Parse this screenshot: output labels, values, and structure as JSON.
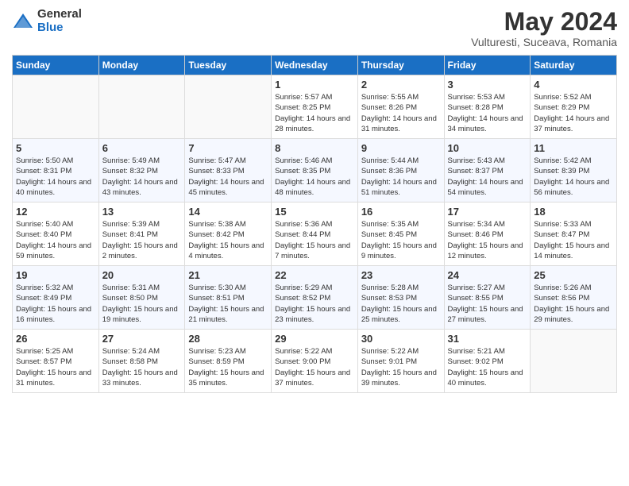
{
  "header": {
    "logo_general": "General",
    "logo_blue": "Blue",
    "main_title": "May 2024",
    "subtitle": "Vulturesti, Suceava, Romania"
  },
  "days_of_week": [
    "Sunday",
    "Monday",
    "Tuesday",
    "Wednesday",
    "Thursday",
    "Friday",
    "Saturday"
  ],
  "weeks": [
    [
      {
        "day": "",
        "info": ""
      },
      {
        "day": "",
        "info": ""
      },
      {
        "day": "",
        "info": ""
      },
      {
        "day": "1",
        "info": "Sunrise: 5:57 AM\nSunset: 8:25 PM\nDaylight: 14 hours\nand 28 minutes."
      },
      {
        "day": "2",
        "info": "Sunrise: 5:55 AM\nSunset: 8:26 PM\nDaylight: 14 hours\nand 31 minutes."
      },
      {
        "day": "3",
        "info": "Sunrise: 5:53 AM\nSunset: 8:28 PM\nDaylight: 14 hours\nand 34 minutes."
      },
      {
        "day": "4",
        "info": "Sunrise: 5:52 AM\nSunset: 8:29 PM\nDaylight: 14 hours\nand 37 minutes."
      }
    ],
    [
      {
        "day": "5",
        "info": "Sunrise: 5:50 AM\nSunset: 8:31 PM\nDaylight: 14 hours\nand 40 minutes."
      },
      {
        "day": "6",
        "info": "Sunrise: 5:49 AM\nSunset: 8:32 PM\nDaylight: 14 hours\nand 43 minutes."
      },
      {
        "day": "7",
        "info": "Sunrise: 5:47 AM\nSunset: 8:33 PM\nDaylight: 14 hours\nand 45 minutes."
      },
      {
        "day": "8",
        "info": "Sunrise: 5:46 AM\nSunset: 8:35 PM\nDaylight: 14 hours\nand 48 minutes."
      },
      {
        "day": "9",
        "info": "Sunrise: 5:44 AM\nSunset: 8:36 PM\nDaylight: 14 hours\nand 51 minutes."
      },
      {
        "day": "10",
        "info": "Sunrise: 5:43 AM\nSunset: 8:37 PM\nDaylight: 14 hours\nand 54 minutes."
      },
      {
        "day": "11",
        "info": "Sunrise: 5:42 AM\nSunset: 8:39 PM\nDaylight: 14 hours\nand 56 minutes."
      }
    ],
    [
      {
        "day": "12",
        "info": "Sunrise: 5:40 AM\nSunset: 8:40 PM\nDaylight: 14 hours\nand 59 minutes."
      },
      {
        "day": "13",
        "info": "Sunrise: 5:39 AM\nSunset: 8:41 PM\nDaylight: 15 hours\nand 2 minutes."
      },
      {
        "day": "14",
        "info": "Sunrise: 5:38 AM\nSunset: 8:42 PM\nDaylight: 15 hours\nand 4 minutes."
      },
      {
        "day": "15",
        "info": "Sunrise: 5:36 AM\nSunset: 8:44 PM\nDaylight: 15 hours\nand 7 minutes."
      },
      {
        "day": "16",
        "info": "Sunrise: 5:35 AM\nSunset: 8:45 PM\nDaylight: 15 hours\nand 9 minutes."
      },
      {
        "day": "17",
        "info": "Sunrise: 5:34 AM\nSunset: 8:46 PM\nDaylight: 15 hours\nand 12 minutes."
      },
      {
        "day": "18",
        "info": "Sunrise: 5:33 AM\nSunset: 8:47 PM\nDaylight: 15 hours\nand 14 minutes."
      }
    ],
    [
      {
        "day": "19",
        "info": "Sunrise: 5:32 AM\nSunset: 8:49 PM\nDaylight: 15 hours\nand 16 minutes."
      },
      {
        "day": "20",
        "info": "Sunrise: 5:31 AM\nSunset: 8:50 PM\nDaylight: 15 hours\nand 19 minutes."
      },
      {
        "day": "21",
        "info": "Sunrise: 5:30 AM\nSunset: 8:51 PM\nDaylight: 15 hours\nand 21 minutes."
      },
      {
        "day": "22",
        "info": "Sunrise: 5:29 AM\nSunset: 8:52 PM\nDaylight: 15 hours\nand 23 minutes."
      },
      {
        "day": "23",
        "info": "Sunrise: 5:28 AM\nSunset: 8:53 PM\nDaylight: 15 hours\nand 25 minutes."
      },
      {
        "day": "24",
        "info": "Sunrise: 5:27 AM\nSunset: 8:55 PM\nDaylight: 15 hours\nand 27 minutes."
      },
      {
        "day": "25",
        "info": "Sunrise: 5:26 AM\nSunset: 8:56 PM\nDaylight: 15 hours\nand 29 minutes."
      }
    ],
    [
      {
        "day": "26",
        "info": "Sunrise: 5:25 AM\nSunset: 8:57 PM\nDaylight: 15 hours\nand 31 minutes."
      },
      {
        "day": "27",
        "info": "Sunrise: 5:24 AM\nSunset: 8:58 PM\nDaylight: 15 hours\nand 33 minutes."
      },
      {
        "day": "28",
        "info": "Sunrise: 5:23 AM\nSunset: 8:59 PM\nDaylight: 15 hours\nand 35 minutes."
      },
      {
        "day": "29",
        "info": "Sunrise: 5:22 AM\nSunset: 9:00 PM\nDaylight: 15 hours\nand 37 minutes."
      },
      {
        "day": "30",
        "info": "Sunrise: 5:22 AM\nSunset: 9:01 PM\nDaylight: 15 hours\nand 39 minutes."
      },
      {
        "day": "31",
        "info": "Sunrise: 5:21 AM\nSunset: 9:02 PM\nDaylight: 15 hours\nand 40 minutes."
      },
      {
        "day": "",
        "info": ""
      }
    ]
  ]
}
